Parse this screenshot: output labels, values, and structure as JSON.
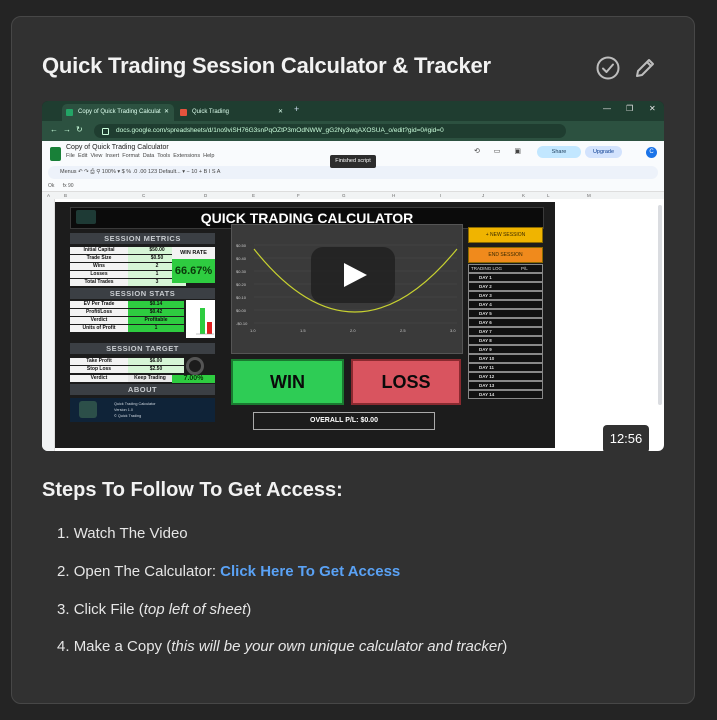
{
  "page": {
    "title": "Quick Trading Session Calculator & Tracker",
    "steps_title": "Steps To Follow To Get Access:",
    "steps": [
      {
        "num": "1.",
        "text": "Watch The Video"
      },
      {
        "num": "2.",
        "prefix": "Open The Calculator: ",
        "link": "Click Here To Get Access"
      },
      {
        "num": "3.",
        "prefix": "Click File (",
        "em": "top left of sheet",
        "suffix": ")"
      },
      {
        "num": "4.",
        "prefix": "Make a Copy (",
        "em": "this will be your own unique calculator and tracker",
        "suffix": ")"
      }
    ]
  },
  "video": {
    "duration": "12:56",
    "browser": {
      "tab1": "Copy of Quick Trading Calculat",
      "tab2": "Quick Trading",
      "url": "docs.google.com/spreadsheets/d/1no9viSH76G3snPqOZtP3mOdNWW_gG2Ny3wqAXOSUA_o/edit?gid=0#gid=0"
    },
    "sheets": {
      "doc_title": "Copy of Quick Trading Calculator",
      "menu": [
        "File",
        "Edit",
        "View",
        "Insert",
        "Format",
        "Data",
        "Tools",
        "Extensions",
        "Help"
      ],
      "toolbar_text": "Menus     ↶  ↷  ⎙  ⚲   100%  ▾   $   %   .0   .00   123   Default...  ▾   −  10  +   B   I   S   A",
      "tooltip": "Finished script",
      "share": "Share",
      "upgrade": "Upgrade",
      "avatar": "C",
      "cell_ref": "Ok",
      "formula": "fx  90",
      "columns": [
        "A",
        "B",
        "C",
        "D",
        "E",
        "F",
        "G",
        "H",
        "I",
        "J",
        "K",
        "L",
        "M"
      ]
    },
    "calc": {
      "title": "QUICK TRADING CALCULATOR",
      "session_metrics": "SESSION METRICS",
      "metrics": [
        {
          "label": "Initial Capital",
          "value": "$50.00"
        },
        {
          "label": "Trade Size",
          "value": "$0.50"
        },
        {
          "label": "Wins",
          "value": "2"
        },
        {
          "label": "Losses",
          "value": "1"
        },
        {
          "label": "Total Trades",
          "value": "3"
        }
      ],
      "win_rate_label": "WIN RATE",
      "win_rate_value": "66.67%",
      "session_stats": "SESSION STATS",
      "stats": [
        {
          "label": "EV Per Trade",
          "value": "$0.14"
        },
        {
          "label": "Profit/Loss",
          "value": "$0.42"
        },
        {
          "label": "Verdict",
          "value": "Profitable"
        },
        {
          "label": "Units of Profit",
          "value": "1"
        }
      ],
      "session_target": "SESSION TARGET",
      "targets": [
        {
          "label": "Take Profit",
          "value": "$6.00"
        },
        {
          "label": "Stop Loss",
          "value": "$2.50"
        },
        {
          "label": "Verdict",
          "value": "Keep Trading"
        }
      ],
      "target_pct": "7.00%",
      "about": "ABOUT",
      "about_lines": [
        "Quick Trading Calculator",
        "Version 1.0",
        "© Quick Trading"
      ],
      "chart": {
        "y_ticks": [
          "$0.50",
          "$0.40",
          "$0.30",
          "$0.20",
          "$0.10",
          "$0.00",
          "-$0.10"
        ],
        "x_ticks": [
          "1.0",
          "1.5",
          "2.0",
          "2.5",
          "3.0"
        ]
      },
      "win": "WIN",
      "loss": "LOSS",
      "overall": "OVERALL P/L: $0.00",
      "new_session": "+ NEW SESSION",
      "end_session": "END SESSION",
      "log_header": "TRADING LOG",
      "log_pl": "P/L",
      "days": [
        "DAY 1",
        "DAY 2",
        "DAY 3",
        "DAY 4",
        "DAY 5",
        "DAY 6",
        "DAY 7",
        "DAY 8",
        "DAY 9",
        "DAY 10",
        "DAY 11",
        "DAY 12",
        "DAY 13",
        "DAY 14"
      ]
    }
  },
  "colors": {
    "background": "#242424",
    "card": "#313131",
    "link": "#5aa2f5",
    "win_green": "#2ecc55",
    "loss_red": "#d9545f"
  },
  "icons": [
    "check-circle-icon",
    "pencil-icon",
    "play-icon"
  ]
}
